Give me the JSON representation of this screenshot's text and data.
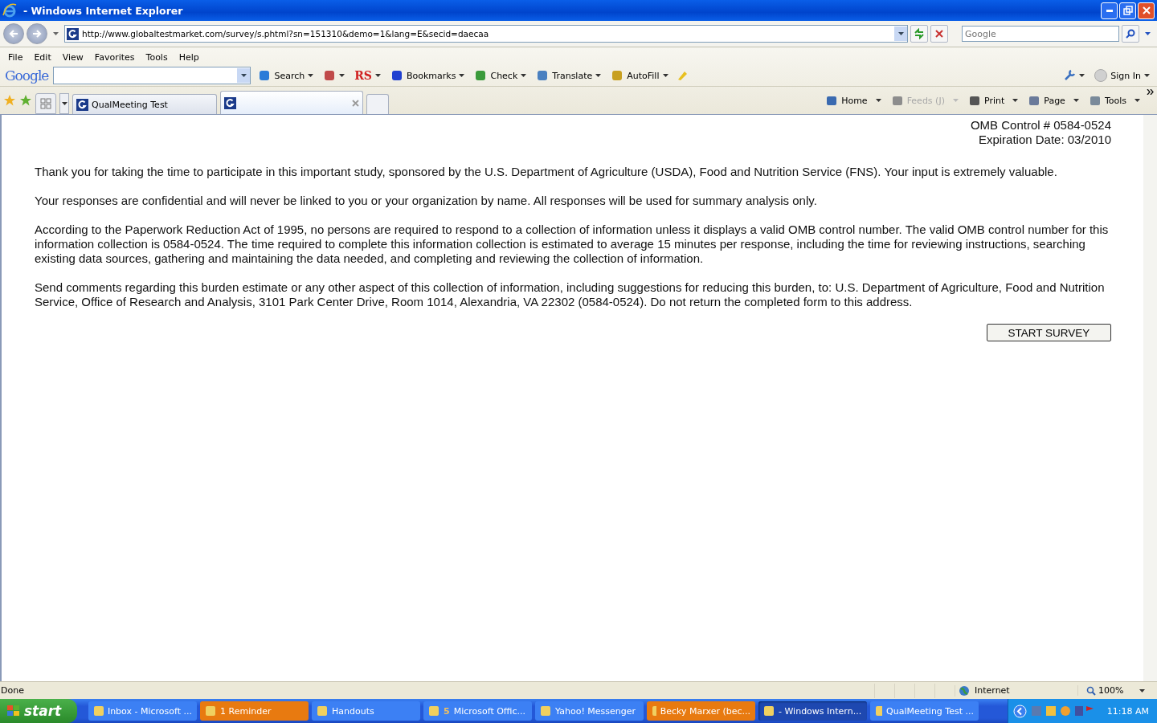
{
  "window": {
    "title": "- Windows Internet Explorer"
  },
  "address_bar": {
    "url": "http://www.globaltestmarket.com/survey/s.phtml?sn=151310&demo=1&lang=E&secid=daecaa"
  },
  "search": {
    "placeholder": "Google"
  },
  "menu": [
    "File",
    "Edit",
    "View",
    "Favorites",
    "Tools",
    "Help"
  ],
  "google_toolbar": {
    "logo": "Google",
    "buttons": [
      {
        "kind": "search",
        "label": "Search"
      },
      {
        "kind": "blank"
      },
      {
        "kind": "bookmarks",
        "label": "Bookmarks"
      },
      {
        "kind": "check",
        "label": "Check"
      },
      {
        "kind": "translate",
        "label": "Translate"
      },
      {
        "kind": "autofill",
        "label": "AutoFill"
      }
    ],
    "rs": "RS",
    "sign_in": "Sign In"
  },
  "tabs": [
    {
      "label": "QualMeeting Test",
      "selected": false
    },
    {
      "selected": true
    }
  ],
  "command_bar": [
    {
      "kind": "home",
      "label": "Home",
      "disabled": false
    },
    {
      "kind": "feeds",
      "label": "Feeds (J)",
      "disabled": true
    },
    {
      "kind": "print",
      "label": "Print",
      "disabled": false
    },
    {
      "kind": "page",
      "label": "Page",
      "disabled": false
    },
    {
      "kind": "tools",
      "label": "Tools",
      "disabled": false
    }
  ],
  "page": {
    "omb_control": "OMB Control # 0584-0524",
    "expiration": "Expiration Date: 03/2010",
    "paragraphs": [
      "Thank you for taking the time to participate in this important study, sponsored by the U.S. Department of Agriculture (USDA), Food and Nutrition Service (FNS). Your input is extremely valuable.",
      "Your responses are confidential and will never be linked to you or your organization by name. All responses will be used for summary analysis only.",
      "According to the Paperwork Reduction Act of 1995, no persons are required to respond to a collection of information unless it displays a valid OMB control number. The valid OMB control number for this information collection is 0584-0524. The time required to complete this information collection is estimated to average 15 minutes per response, including the time for reviewing instructions, searching existing data sources, gathering and maintaining the data needed, and completing and reviewing the collection of information.",
      "Send comments regarding this burden estimate or any other aspect of this collection of information, including suggestions for reducing this burden, to: U.S. Department of Agriculture, Food and Nutrition Service, Office of Research and Analysis, 3101 Park Center Drive, Room 1014, Alexandria, VA 22302 (0584-0524). Do not return the completed form to this address."
    ],
    "button": "START SURVEY"
  },
  "status_bar": {
    "text": "Done",
    "zone": "Internet",
    "zoom": "100%"
  },
  "taskbar": {
    "start": "start",
    "items": [
      {
        "label": "Inbox - Microsoft ...",
        "flashing": false,
        "selected": false
      },
      {
        "label": "1 Reminder",
        "flashing": true,
        "selected": false
      },
      {
        "label": "Handouts",
        "flashing": false,
        "selected": false
      },
      {
        "label": "Microsoft Offic...",
        "count": "5",
        "flashing": false,
        "selected": false
      },
      {
        "label": "Yahoo! Messenger",
        "flashing": false,
        "selected": false
      },
      {
        "label": "Becky Marxer (bec...",
        "flashing": true,
        "selected": false
      },
      {
        "label": "- Windows Intern...",
        "flashing": false,
        "selected": true
      },
      {
        "label": "QualMeeting Test ...",
        "flashing": false,
        "selected": false
      }
    ],
    "clock": "11:18 AM"
  }
}
